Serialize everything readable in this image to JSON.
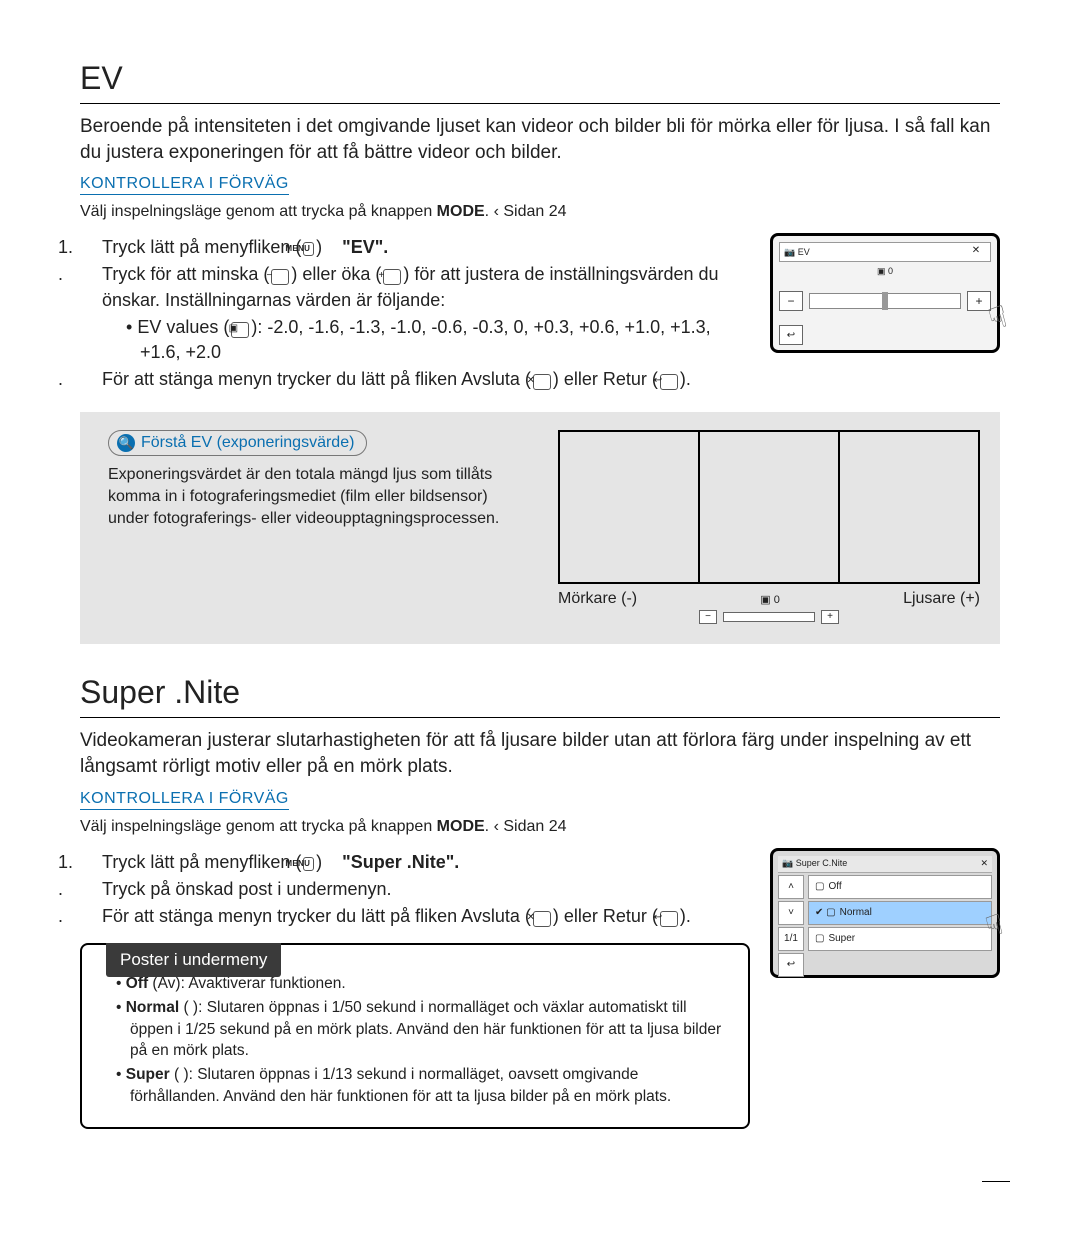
{
  "ev": {
    "title": "EV",
    "intro": "Beroende på intensiteten i det omgivande ljuset kan videor och bilder bli för mörka eller för ljusa. I så fall kan du justera exponeringen för att få bättre videor och bilder.",
    "precheck_label": "KONTROLLERA I FÖRVÄG",
    "precheck_text_a": "Välj inspelningsläge genom att trycka på knappen ",
    "precheck_text_mode": "MODE",
    "precheck_text_b": ".  ‹ Sidan 24",
    "step1_a": "Tryck lätt på menyfliken (",
    "step1_menu": "MENU",
    "step1_b": ")",
    "step1_arrow": "   ",
    "step1_c": "\"EV\".",
    "step2_a": "Tryck för att minska (",
    "step2_b": ") eller öka (",
    "step2_c": ") för att justera de inställningsvärden du önskar. Inställningarnas värden är följande:",
    "values_label": "EV values (",
    "values_text": "): -2.0, -1.6, -1.3, -1.0, -0.6, -0.3, 0, +0.3, +0.6, +1.0, +1.3, +1.6, +2.0",
    "step3_a": "För att stänga menyn trycker du lätt på fliken Avsluta (",
    "step3_b": ") eller Retur (",
    "step3_c": ").",
    "callout": "Förstå EV (exponeringsvärde)",
    "callout_text": "Exponeringsvärdet är den totala mängd ljus som tillåts komma in i fotograferingsmediet (film eller bildsensor) under fotograferings- eller videoupptagningsprocessen.",
    "darker": "Mörkare (-)",
    "lighter": "Ljusare (+)",
    "center_tag": "0",
    "lcd_title": "EV",
    "lcd_close": "✕",
    "lcd_center": "0",
    "minus": "−",
    "plus": "+",
    "back": "↩"
  },
  "scn": {
    "title": "Super .Nite",
    "intro": "Videokameran justerar slutarhastigheten för att få ljusare bilder utan att förlora färg under inspelning av ett långsamt rörligt motiv eller på en mörk plats.",
    "precheck_label": "KONTROLLERA I FÖRVÄG",
    "precheck_text_a": "Välj inspelningsläge genom att trycka på knappen ",
    "precheck_text_mode": "MODE",
    "precheck_text_b": ".  ‹ Sidan 24",
    "step1_a": "Tryck lätt på menyfliken (",
    "step1_menu": "MENU",
    "step1_b": ")",
    "step1_c": "\"Super .Nite\".",
    "step2": "Tryck på önskad post i undermenyn.",
    "step3_a": "För att stänga menyn trycker du lätt på fliken Avsluta (",
    "step3_b": ") eller Retur (",
    "step3_c": ").",
    "lcd_title": "Super C.Nite",
    "lcd_close": "✕",
    "nav_up": "˄",
    "nav_down": "˅",
    "nav_page": "1/1",
    "nav_back": "↩",
    "item_off": "Off",
    "item_normal": "Normal",
    "item_super": "Super",
    "submenu_tab": "Poster i undermeny",
    "sub_off_b": "Off",
    "sub_off": " (Av): Avaktiverar funktionen.",
    "sub_normal_b": "Normal",
    "sub_normal": " (   ): Slutaren öppnas i 1/50 sekund i normalläget och växlar automatiskt till öppen i 1/25 sekund på en mörk plats. Använd den här funktionen för att ta ljusa bilder på en mörk plats.",
    "sub_super_b": "Super",
    "sub_super": " (   ): Slutaren öppnas i 1/13 sekund i normalläget, oavsett omgivande förhållanden. Använd den här funktionen för att ta ljusa bilder på en mörk plats."
  }
}
